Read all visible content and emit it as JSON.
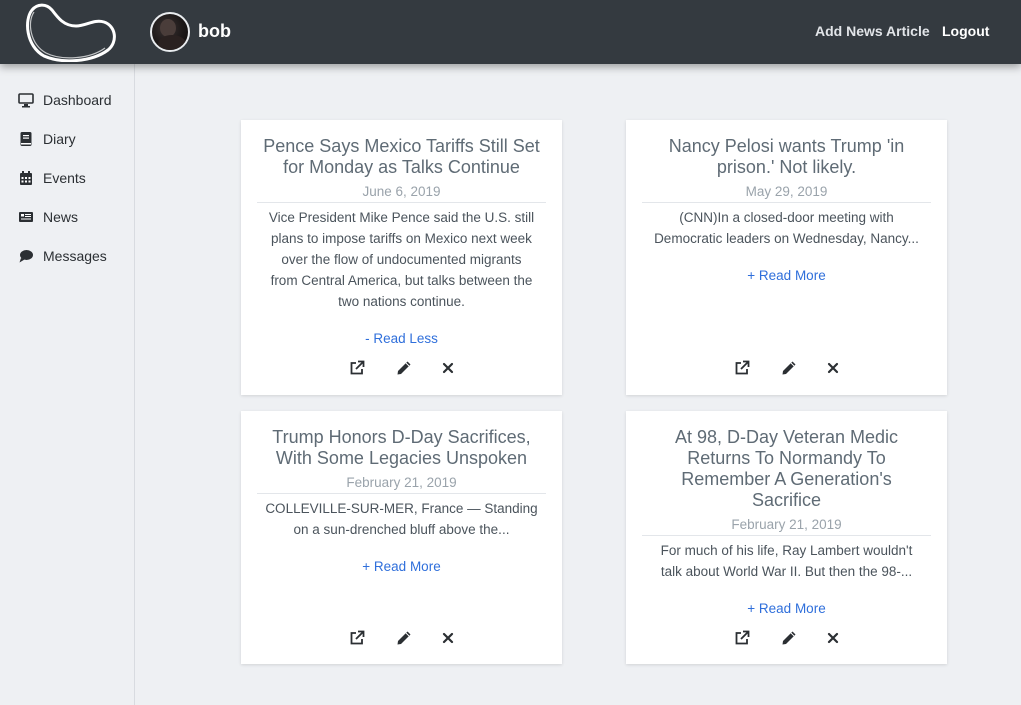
{
  "header": {
    "username": "bob",
    "nav": {
      "add_article": "Add News Article",
      "logout": "Logout"
    }
  },
  "sidebar": {
    "items": [
      {
        "label": "Dashboard",
        "icon": "monitor-icon"
      },
      {
        "label": "Diary",
        "icon": "book-icon"
      },
      {
        "label": "Events",
        "icon": "calendar-icon"
      },
      {
        "label": "News",
        "icon": "newspaper-icon"
      },
      {
        "label": "Messages",
        "icon": "chat-bubble-icon"
      }
    ]
  },
  "articles": [
    {
      "title_lines": [
        "Pence Says Mexico Tariffs Still Set",
        "for Monday as Talks Continue"
      ],
      "date": "June 6, 2019",
      "body_lines": [
        "Vice President Mike Pence said the U.S. still",
        "plans to impose tariffs on Mexico next week",
        "over the flow of undocumented migrants",
        "from Central America, but talks between the",
        "two nations continue."
      ],
      "read_label": "- Read Less"
    },
    {
      "title_lines": [
        "Nancy Pelosi wants Trump 'in",
        "prison.' Not likely."
      ],
      "date": "May 29, 2019",
      "body_lines": [
        "(CNN)In a closed-door meeting with",
        "Democratic leaders on Wednesday, Nancy..."
      ],
      "read_label": "+ Read More"
    },
    {
      "title_lines": [
        "Trump Honors D-Day Sacrifices,",
        "With Some Legacies Unspoken"
      ],
      "date": "February 21, 2019",
      "body_lines": [
        "COLLEVILLE-SUR-MER, France — Standing",
        "on a sun-drenched bluff above the..."
      ],
      "read_label": "+ Read More"
    },
    {
      "title_lines": [
        "At 98, D-Day Veteran Medic",
        "Returns To Normandy To",
        "Remember A Generation's",
        "Sacrifice"
      ],
      "date": "February 21, 2019",
      "body_lines": [
        "For much of his life, Ray Lambert wouldn't",
        "talk about World War II. But then the 98-..."
      ],
      "read_label": "+ Read More"
    }
  ],
  "theme": {
    "topbar": "#343a40",
    "link": "#2f6fdb",
    "background": "#eef0f3"
  }
}
